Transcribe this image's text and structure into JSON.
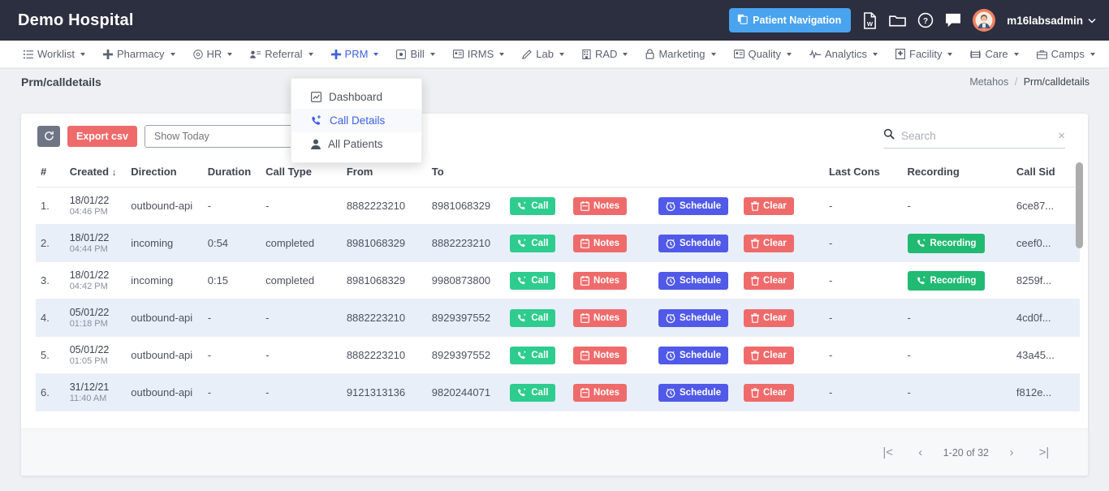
{
  "header": {
    "brand": "Demo Hospital",
    "patient_nav_label": "Patient Navigation",
    "username": "m16labsadmin",
    "icons": [
      "word-doc-icon",
      "folder-icon",
      "help-circle-icon",
      "chat-bubble-icon"
    ]
  },
  "nav": {
    "items": [
      {
        "label": "Worklist",
        "icon": "list-icon",
        "active": false
      },
      {
        "label": "Pharmacy",
        "icon": "plus-icon",
        "active": false
      },
      {
        "label": "HR",
        "icon": "at-circle-icon",
        "active": false
      },
      {
        "label": "Referral",
        "icon": "user-list-icon",
        "active": false
      },
      {
        "label": "PRM",
        "icon": "plus-icon",
        "active": true
      },
      {
        "label": "Bill",
        "icon": "square-dot-icon",
        "active": false
      },
      {
        "label": "IRMS",
        "icon": "id-card-icon",
        "active": false
      },
      {
        "label": "Lab",
        "icon": "pen-icon",
        "active": false
      },
      {
        "label": "RAD",
        "icon": "building-icon",
        "active": false
      },
      {
        "label": "Marketing",
        "icon": "lock-icon",
        "active": false
      },
      {
        "label": "Quality",
        "icon": "id-card-icon",
        "active": false
      },
      {
        "label": "Analytics",
        "icon": "pulse-icon",
        "active": false
      },
      {
        "label": "Facility",
        "icon": "hospital-icon",
        "active": false
      },
      {
        "label": "Care",
        "icon": "bed-icon",
        "active": false
      },
      {
        "label": "Camps",
        "icon": "briefcase-icon",
        "active": false
      }
    ]
  },
  "dropdown": {
    "items": [
      {
        "label": "Dashboard",
        "icon": "chart-square-icon",
        "active": false
      },
      {
        "label": "Call Details",
        "icon": "phone-plus-icon",
        "active": true
      },
      {
        "label": "All Patients",
        "icon": "user-icon",
        "active": false
      }
    ]
  },
  "breadcrumb": {
    "title": "Prm/calldetails",
    "root": "Metahos",
    "separator": "/",
    "current": "Prm/calldetails"
  },
  "toolbar": {
    "refresh_icon": "refresh-icon",
    "export_label": "Export csv",
    "show_today_label": "Show Today",
    "search_icon": "search-icon"
  },
  "search": {
    "placeholder": "Search",
    "value": "",
    "clear_label": "×"
  },
  "table": {
    "columns": [
      "#",
      "Created",
      "Direction",
      "Duration",
      "Call Type",
      "From",
      "To",
      "",
      "",
      "",
      "",
      "Last Cons",
      "Recording",
      "Call Sid"
    ],
    "sort_column": "Created",
    "sort_icon": "arrow-down-icon",
    "action_labels": {
      "call": "Call",
      "notes": "Notes",
      "schedule": "Schedule",
      "clear": "Clear",
      "recording": "Recording"
    },
    "rows": [
      {
        "index": "1.",
        "date": "18/01/22",
        "time": "04:46 PM",
        "direction": "outbound-api",
        "duration": "-",
        "call_type": "-",
        "from": "8882223210",
        "to": "8981068329",
        "last_cons": "-",
        "recording": "-",
        "call_sid": "6ce87...",
        "has_recording": false
      },
      {
        "index": "2.",
        "date": "18/01/22",
        "time": "04:44 PM",
        "direction": "incoming",
        "duration": "0:54",
        "call_type": "completed",
        "from": "8981068329",
        "to": "8882223210",
        "last_cons": "-",
        "recording": "Recording",
        "call_sid": "ceef0...",
        "has_recording": true
      },
      {
        "index": "3.",
        "date": "18/01/22",
        "time": "04:42 PM",
        "direction": "incoming",
        "duration": "0:15",
        "call_type": "completed",
        "from": "8981068329",
        "to": "9980873800",
        "last_cons": "-",
        "recording": "Recording",
        "call_sid": "8259f...",
        "has_recording": true
      },
      {
        "index": "4.",
        "date": "05/01/22",
        "time": "01:18 PM",
        "direction": "outbound-api",
        "duration": "-",
        "call_type": "-",
        "from": "8882223210",
        "to": "8929397552",
        "last_cons": "-",
        "recording": "-",
        "call_sid": "4cd0f...",
        "has_recording": false
      },
      {
        "index": "5.",
        "date": "05/01/22",
        "time": "01:05 PM",
        "direction": "outbound-api",
        "duration": "-",
        "call_type": "-",
        "from": "8882223210",
        "to": "8929397552",
        "last_cons": "-",
        "recording": "-",
        "call_sid": "43a45...",
        "has_recording": false
      },
      {
        "index": "6.",
        "date": "31/12/21",
        "time": "11:40 AM",
        "direction": "outbound-api",
        "duration": "-",
        "call_type": "-",
        "from": "9121313136",
        "to": "9820244071",
        "last_cons": "-",
        "recording": "-",
        "call_sid": "f812e...",
        "has_recording": false
      }
    ]
  },
  "pagination": {
    "first": "|<",
    "prev": "‹",
    "range": "1-20 of 32",
    "next": "›",
    "last": ">|"
  },
  "colors": {
    "header_bg": "#2b2f3f",
    "accent_blue": "#4aa3ef",
    "link_blue": "#3f60e4",
    "danger": "#ef6b6b",
    "success": "#2ecc8f",
    "schedule": "#5159e8",
    "row_alt": "#e9eff8"
  }
}
